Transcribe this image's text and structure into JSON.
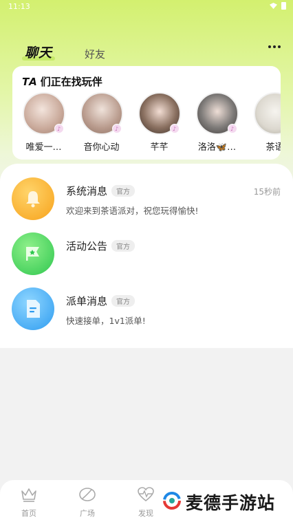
{
  "status_bar": {
    "time": "11:13"
  },
  "header": {
    "tabs": [
      {
        "label": "聊天",
        "active": true
      },
      {
        "label": "好友",
        "active": false
      }
    ]
  },
  "finder": {
    "title_prefix": "TA",
    "title_rest": "们正在找玩伴",
    "companions": [
      {
        "name": "唯爱一…",
        "avatar_color": "#c9a99a"
      },
      {
        "name": "音你心动",
        "avatar_color": "#b89a8c"
      },
      {
        "name": "芊芊",
        "avatar_color": "#8a7060"
      },
      {
        "name": "洛洛🦋…",
        "avatar_color": "#7d7a78"
      },
      {
        "name": "茶语",
        "avatar_color": "#dcd8cf"
      }
    ]
  },
  "messages": [
    {
      "title": "系统消息",
      "tag": "官方",
      "preview": "欢迎来到茶语派对，祝您玩得愉快!",
      "time": "15秒前",
      "icon": "bell-icon"
    },
    {
      "title": "活动公告",
      "tag": "官方",
      "preview": "",
      "time": "",
      "icon": "flag-star-icon"
    },
    {
      "title": "派单消息",
      "tag": "官方",
      "preview": "快速接单，1v1派单!",
      "time": "",
      "icon": "document-icon"
    }
  ],
  "bottom_nav": [
    {
      "label": "首页",
      "icon": "crown-icon"
    },
    {
      "label": "广场",
      "icon": "leaf-icon"
    },
    {
      "label": "发现",
      "icon": "heartbeat-icon"
    }
  ],
  "watermark": {
    "text": "麦德手游站"
  },
  "colors": {
    "accent": "#c9ec5a",
    "system": "#f7a21b",
    "activity": "#2fc74f",
    "order": "#2e9cf0"
  }
}
